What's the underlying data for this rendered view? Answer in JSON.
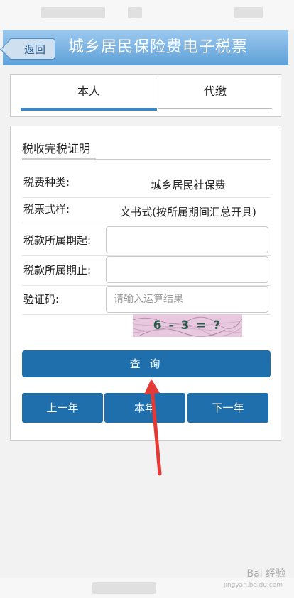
{
  "header": {
    "back_label": "返回",
    "title": "城乡居民保险费电子税票"
  },
  "tabs": [
    {
      "label": "本人",
      "active": true
    },
    {
      "label": "代缴",
      "active": false
    }
  ],
  "form": {
    "section_title": "税收完税证明",
    "rows": {
      "fee_type_label": "税费种类:",
      "fee_type_value": "城乡居民社保费",
      "ticket_style_label": "税票式样:",
      "ticket_style_value": "文书式(按所属期间汇总开具)",
      "period_start_label": "税款所属期起:",
      "period_start_value": "",
      "period_end_label": "税款所属期止:",
      "period_end_value": "",
      "captcha_label": "验证码:",
      "captcha_placeholder": "请输入运算结果",
      "captcha_image_text": "6 - 3 = ?"
    },
    "query_button": "查 询",
    "year_buttons": [
      "上一年",
      "本年",
      "下一年"
    ]
  },
  "watermark": {
    "text": "Bai 经验",
    "sub": "jingyan.baidu.com"
  },
  "colors": {
    "header": "#5fa1d8",
    "button": "#1f6fad",
    "annotation_arrow": "#e53935"
  }
}
